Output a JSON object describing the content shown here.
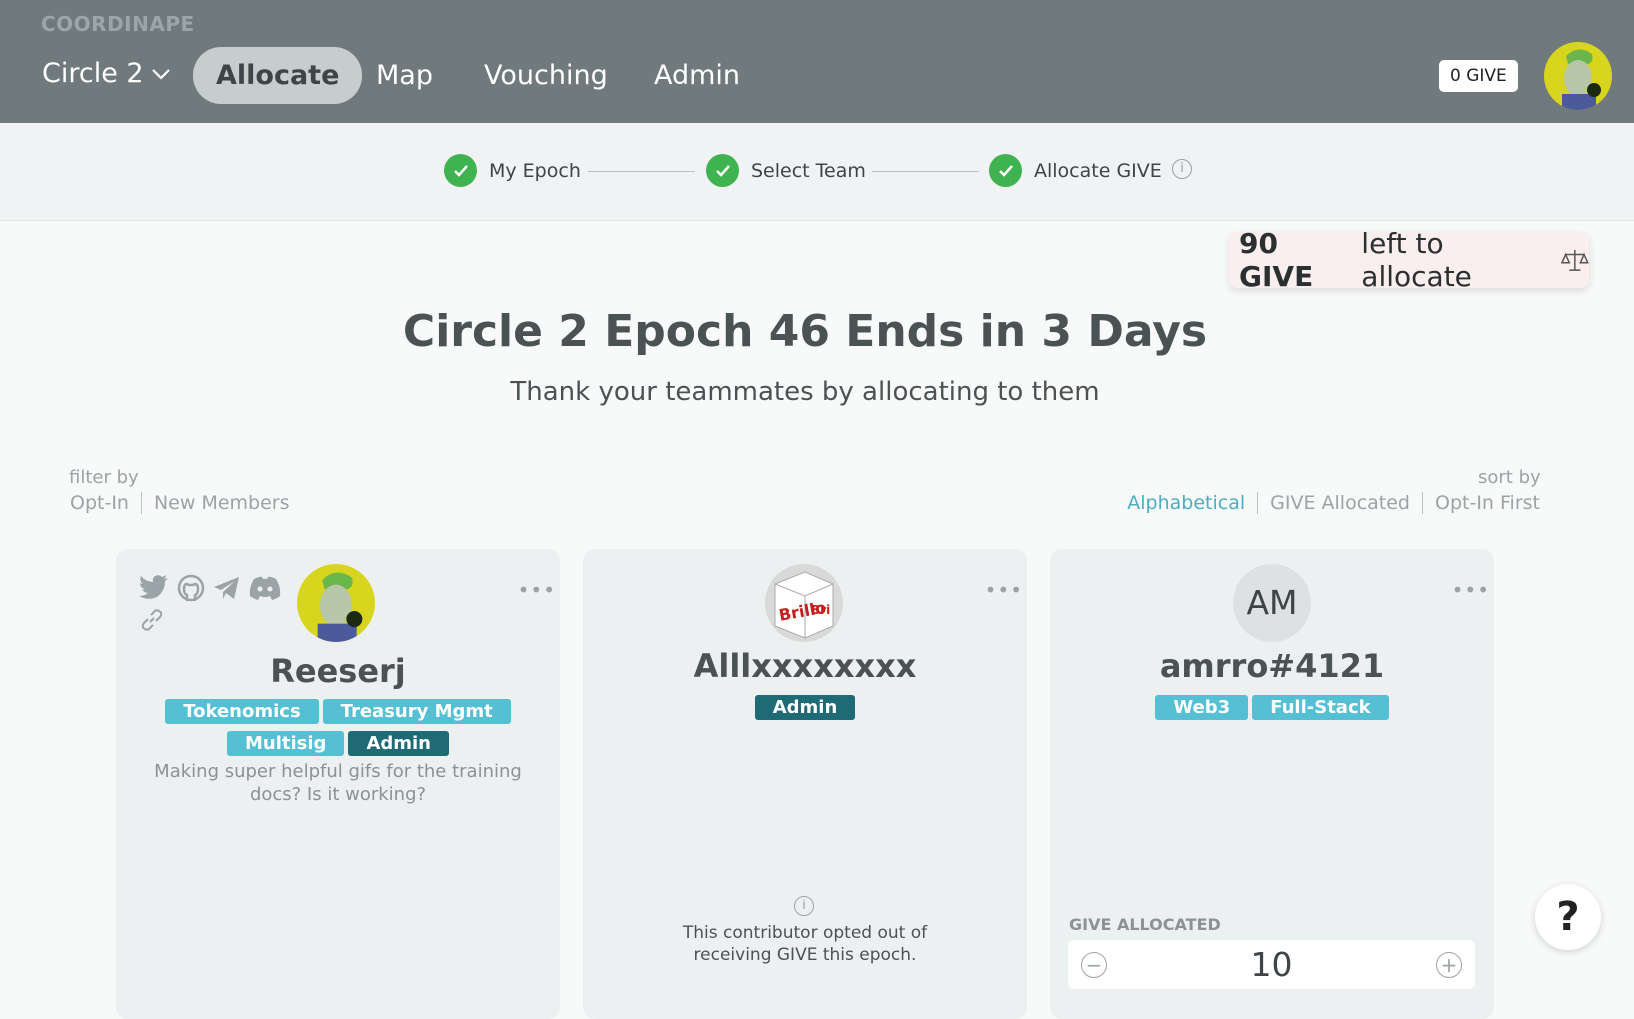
{
  "app": {
    "brand": "COORDINAPE"
  },
  "nav": {
    "circle_selector": "Circle 2",
    "items": [
      {
        "label": "Allocate",
        "active": true
      },
      {
        "label": "Map"
      },
      {
        "label": "Vouching"
      },
      {
        "label": "Admin"
      }
    ],
    "give_balance": "0 GIVE"
  },
  "stepper": {
    "steps": [
      {
        "label": "My Epoch",
        "done": true
      },
      {
        "label": "Select Team",
        "done": true
      },
      {
        "label": "Allocate GIVE",
        "done": true
      }
    ]
  },
  "give_left": {
    "amount": "90 GIVE",
    "text": "left to allocate"
  },
  "epoch": {
    "title": "Circle 2 Epoch 46 Ends in 3 Days",
    "subtitle": "Thank your teammates by allocating to them"
  },
  "filter": {
    "label": "filter by",
    "options": [
      "Opt-In",
      "New Members"
    ]
  },
  "sort": {
    "label": "sort by",
    "options": [
      "Alphabetical",
      "GIVE Allocated",
      "Opt-In First"
    ],
    "active": "Alphabetical"
  },
  "cards": [
    {
      "name": "Reeserj",
      "tags": [
        "Tokenomics",
        "Treasury Mgmt",
        "Multisig",
        "Admin"
      ],
      "bio": "Making super helpful gifs for the training docs? Is it working?"
    },
    {
      "name": "Alllxxxxxxxx",
      "tags": [
        "Admin"
      ],
      "opted_out_text": "This contributor opted out of receiving GIVE this epoch."
    },
    {
      "name": "amrro#4121",
      "initials": "AM",
      "tags": [
        "Web3",
        "Full-Stack"
      ],
      "give_allocated_label": "GIVE ALLOCATED",
      "give_allocated_value": "10"
    }
  ],
  "help": {
    "label": "?"
  },
  "colors": {
    "topbar": "#707a7d",
    "accent": "#55bfd4",
    "success": "#3fb34f",
    "tag_dark": "#1e6a75"
  }
}
